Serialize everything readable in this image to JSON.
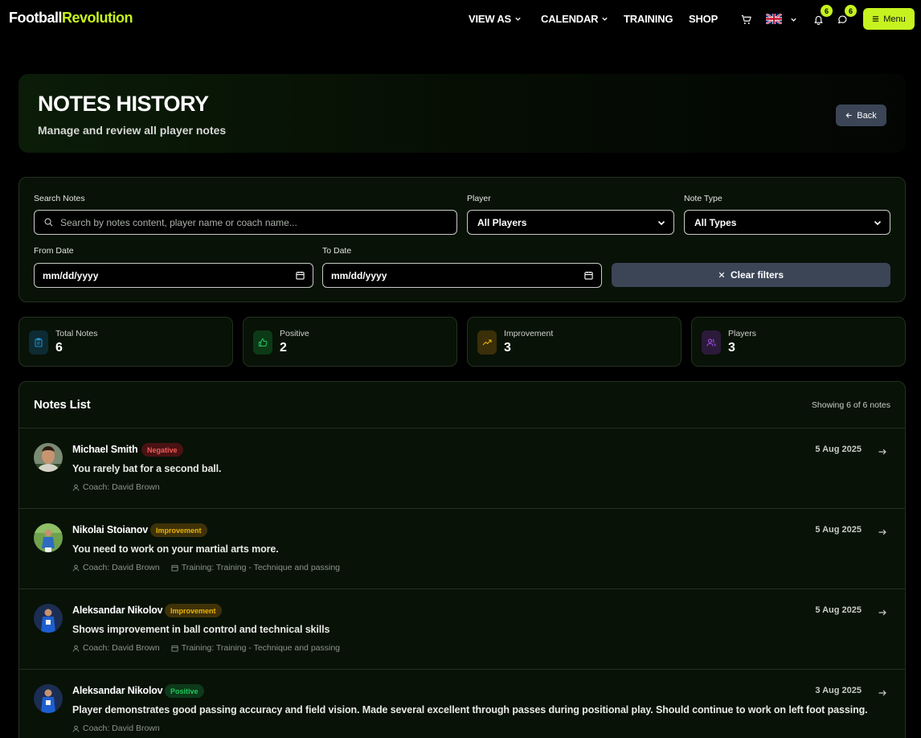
{
  "navbar": {
    "logo_part1": "Football",
    "logo_part2": "Revolution",
    "links": [
      "VIEW AS",
      "CALENDAR",
      "TRAINING",
      "SHOP"
    ],
    "notifications_count": "6",
    "messages_count": "6",
    "menu_label": "Menu"
  },
  "header": {
    "title": "NOTES HISTORY",
    "subtitle": "Manage and review all player notes",
    "back_label": "Back"
  },
  "filters": {
    "search_label": "Search Notes",
    "search_placeholder": "Search by notes content, player name or coach name...",
    "player_label": "Player",
    "player_value": "All Players",
    "type_label": "Note Type",
    "type_value": "All Types",
    "from_label": "From Date",
    "from_value": "mm/dd/yyyy",
    "to_label": "To Date",
    "to_value": "mm/dd/yyyy",
    "clear_label": "Clear filters"
  },
  "stats": [
    {
      "label": "Total Notes",
      "value": "6",
      "icon": "clipboard-icon",
      "color": "#1f8fc7"
    },
    {
      "label": "Positive",
      "value": "2",
      "icon": "thumbs-up-icon",
      "color": "#22c55e"
    },
    {
      "label": "Improvement",
      "value": "3",
      "icon": "trending-up-icon",
      "color": "#eab308"
    },
    {
      "label": "Players",
      "value": "3",
      "icon": "users-icon",
      "color": "#a855f7"
    }
  ],
  "notes": {
    "title": "Notes List",
    "count_text": "Showing 6 of 6 notes",
    "items": [
      {
        "player": "Michael Smith",
        "type": "Negative",
        "text": "You rarely bat for a second ball.",
        "coach": "Coach: David Brown",
        "training": "",
        "date": "5 Aug 2025"
      },
      {
        "player": "Nikolai Stoianov",
        "type": "Improvement",
        "text": "You need to work on your martial arts more.",
        "coach": "Coach: David Brown",
        "training": "Training: Training - Technique and passing",
        "date": "5 Aug 2025"
      },
      {
        "player": "Aleksandar Nikolov",
        "type": "Improvement",
        "text": "Shows improvement in ball control and technical skills",
        "coach": "Coach: David Brown",
        "training": "Training: Training - Technique and passing",
        "date": "5 Aug 2025"
      },
      {
        "player": "Aleksandar Nikolov",
        "type": "Positive",
        "text": "Player demonstrates good passing accuracy and field vision. Made several excellent through passes during positional play. Should continue to work on left foot passing.",
        "coach": "Coach: David Brown",
        "training": "",
        "date": "3 Aug 2025"
      }
    ]
  },
  "colors": {
    "accent": "#c6f31f",
    "negative": "#ef4444",
    "improvement": "#eab308",
    "positive": "#22c55e"
  }
}
